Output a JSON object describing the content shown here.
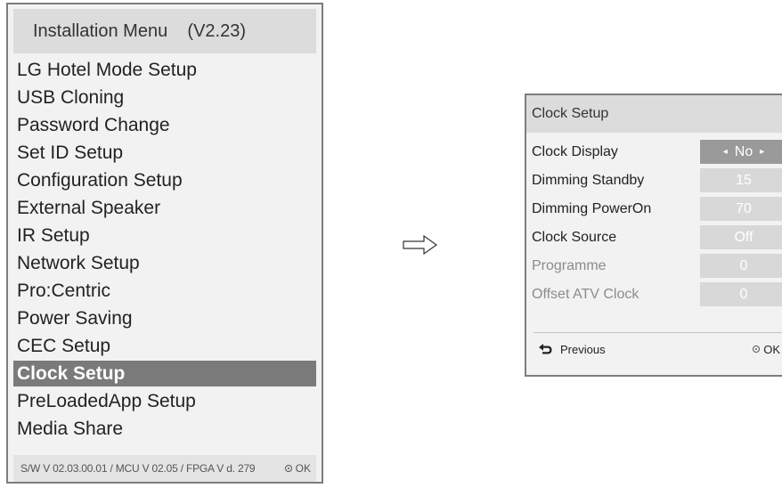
{
  "installation_menu": {
    "title": "Installation Menu    (V2.23)",
    "items": [
      {
        "label": "LG Hotel Mode Setup",
        "selected": false
      },
      {
        "label": "USB Cloning",
        "selected": false
      },
      {
        "label": "Password Change",
        "selected": false
      },
      {
        "label": "Set ID Setup",
        "selected": false
      },
      {
        "label": "Configuration Setup",
        "selected": false
      },
      {
        "label": "External Speaker",
        "selected": false
      },
      {
        "label": "IR Setup",
        "selected": false
      },
      {
        "label": "Network Setup",
        "selected": false
      },
      {
        "label": "Pro:Centric",
        "selected": false
      },
      {
        "label": "Power Saving",
        "selected": false
      },
      {
        "label": "CEC Setup",
        "selected": false
      },
      {
        "label": "Clock Setup",
        "selected": true
      },
      {
        "label": "PreLoadedApp Setup",
        "selected": false
      },
      {
        "label": "Media Share",
        "selected": false
      }
    ],
    "footer_version": "S/W V 02.03.00.01 / MCU V 02.05 / FPGA V d. 279",
    "footer_ok": "OK"
  },
  "clock_setup": {
    "title": "Clock Setup",
    "rows": [
      {
        "label": "Clock Display",
        "value": "No",
        "state": "active"
      },
      {
        "label": "Dimming Standby",
        "value": "15",
        "state": "normal"
      },
      {
        "label": "Dimming PowerOn",
        "value": "70",
        "state": "normal"
      },
      {
        "label": "Clock Source",
        "value": "Off",
        "state": "normal"
      },
      {
        "label": "Programme",
        "value": "0",
        "state": "disabled"
      },
      {
        "label": "Offset ATV Clock",
        "value": "0",
        "state": "disabled"
      }
    ],
    "previous_label": "Previous",
    "ok_label": "OK"
  },
  "icons": {
    "arrow_left": "◂",
    "arrow_right": "▸",
    "back": "back-icon",
    "ok": "ok-dot-icon",
    "flow": "right-arrow-icon"
  },
  "colors": {
    "selected_bg": "#7a7a7a",
    "header_bg": "#dcdcdc",
    "panel_bg": "#f2f2f2",
    "active_value_bg": "#9a9a9a",
    "value_bg": "#d8d8d8",
    "disabled_text": "#8c8c8c"
  }
}
